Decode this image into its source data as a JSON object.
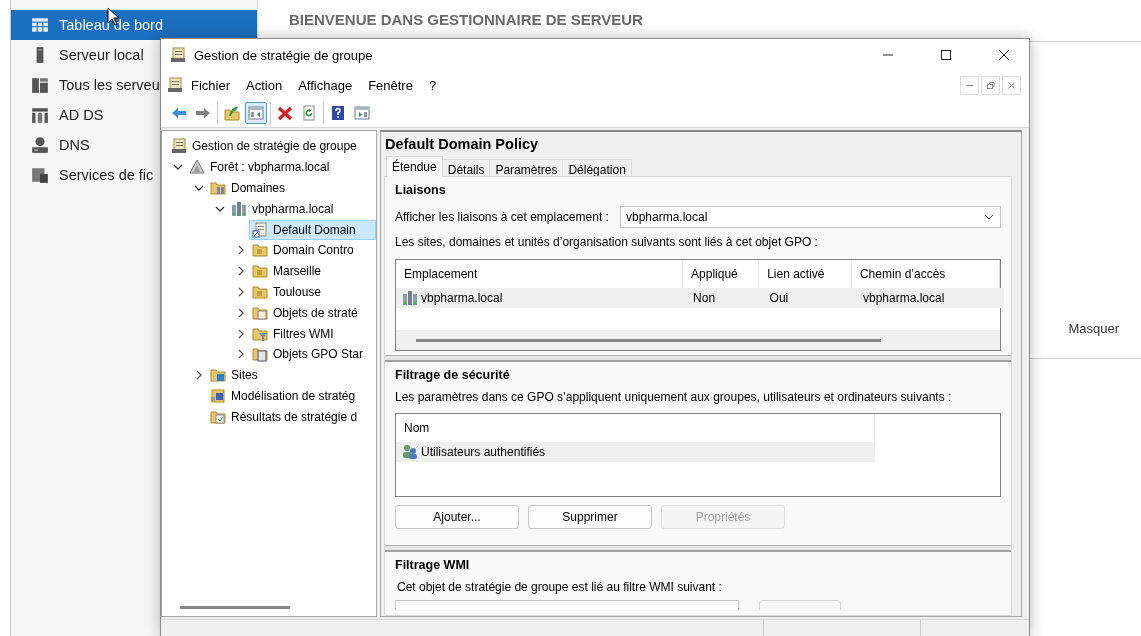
{
  "server_manager": {
    "heading": "BIENVENUE DANS GESTIONNAIRE DE SERVEUR",
    "nav": [
      {
        "label": "Tableau de bord",
        "kind": "dashboard",
        "selected": true
      },
      {
        "label": "Serveur local",
        "kind": "server",
        "selected": false
      },
      {
        "label": "Tous les serveu",
        "kind": "servers",
        "selected": false
      },
      {
        "label": "AD DS",
        "kind": "adds",
        "selected": false
      },
      {
        "label": "DNS",
        "kind": "dns",
        "selected": false
      },
      {
        "label": "Services de fic",
        "kind": "files",
        "selected": false
      }
    ],
    "hide_link": "Masquer"
  },
  "window": {
    "title": "Gestion de stratégie de groupe",
    "menu": [
      "Fichier",
      "Action",
      "Affichage",
      "Fenêtre",
      "?"
    ],
    "toolbar": [
      [
        {
          "kind": "back",
          "pressed": false
        },
        {
          "kind": "forward",
          "pressed": false
        }
      ],
      [
        {
          "kind": "up",
          "pressed": false
        },
        {
          "kind": "console",
          "pressed": true
        }
      ],
      [
        {
          "kind": "delete",
          "pressed": false
        },
        {
          "kind": "refresh",
          "pressed": false
        }
      ],
      [
        {
          "kind": "help",
          "pressed": false
        },
        {
          "kind": "panel",
          "pressed": false
        }
      ]
    ],
    "tree": [
      {
        "label": "Gestion de stratégie de groupe",
        "kind": "gpmc",
        "selected": false,
        "children": [
          {
            "label": "Forêt : vbpharma.local",
            "kind": "forest",
            "expanded": true,
            "selected": false,
            "children": [
              {
                "label": "Domaines",
                "kind": "domains",
                "expanded": true,
                "selected": false,
                "children": [
                  {
                    "label": "vbpharma.local",
                    "kind": "domain",
                    "expanded": true,
                    "selected": false,
                    "children": [
                      {
                        "label": "Default Domain",
                        "kind": "gpo",
                        "selected": true
                      },
                      {
                        "label": "Domain Contro",
                        "kind": "ou",
                        "expanded": false,
                        "selected": false
                      },
                      {
                        "label": "Marseille",
                        "kind": "ou",
                        "expanded": false,
                        "selected": false
                      },
                      {
                        "label": "Toulouse",
                        "kind": "ou",
                        "expanded": false,
                        "selected": false
                      },
                      {
                        "label": "Objets de straté",
                        "kind": "gpofolder",
                        "expanded": false,
                        "selected": false
                      },
                      {
                        "label": "Filtres WMI",
                        "kind": "wmi",
                        "expanded": false,
                        "selected": false
                      },
                      {
                        "label": "Objets GPO Star",
                        "kind": "starter",
                        "expanded": false,
                        "selected": false
                      }
                    ]
                  }
                ]
              },
              {
                "label": "Sites",
                "kind": "sites",
                "expanded": false,
                "selected": false
              },
              {
                "label": "Modélisation de stratég",
                "kind": "modeling",
                "selected": false
              },
              {
                "label": "Résultats de stratégie d",
                "kind": "results",
                "selected": false
              }
            ]
          }
        ]
      }
    ],
    "details": {
      "title": "Default Domain Policy",
      "tabs": [
        {
          "label": "Étendue",
          "selected": true
        },
        {
          "label": "Détails",
          "selected": false
        },
        {
          "label": "Paramètres",
          "selected": false
        },
        {
          "label": "Délégation",
          "selected": false
        }
      ],
      "links": {
        "heading": "Liaisons",
        "location_label": "Afficher les liaisons à cet emplacement :",
        "location_value": "vbpharma.local",
        "description": "Les sites, domaines et unités d’organisation suivants sont liés à cet objet GPO :",
        "columns": [
          "Emplacement",
          "Appliqué",
          "Lien activé",
          "Chemin d’accès"
        ],
        "rows": [
          {
            "cells": [
              "vbpharma.local",
              "Non",
              "Oui",
              "vbpharma.local"
            ],
            "selected": true
          }
        ]
      },
      "security": {
        "heading": "Filtrage de sécurité",
        "description": "Les paramètres dans ce GPO s’appliquent uniquement aux groupes, utilisateurs et ordinateurs suivants :",
        "columns": [
          "Nom"
        ],
        "rows": [
          {
            "cells": [
              "Utilisateurs authentifiés"
            ],
            "selected": true
          }
        ],
        "buttons": [
          {
            "label": "Ajouter...",
            "disabled": false
          },
          {
            "label": "Supprimer",
            "disabled": false
          },
          {
            "label": "Propriétés",
            "disabled": true
          }
        ]
      },
      "wmi": {
        "heading": "Filtrage WMI",
        "description": "Cet objet de stratégie de groupe est lié au filtre WMI suivant :"
      }
    }
  }
}
